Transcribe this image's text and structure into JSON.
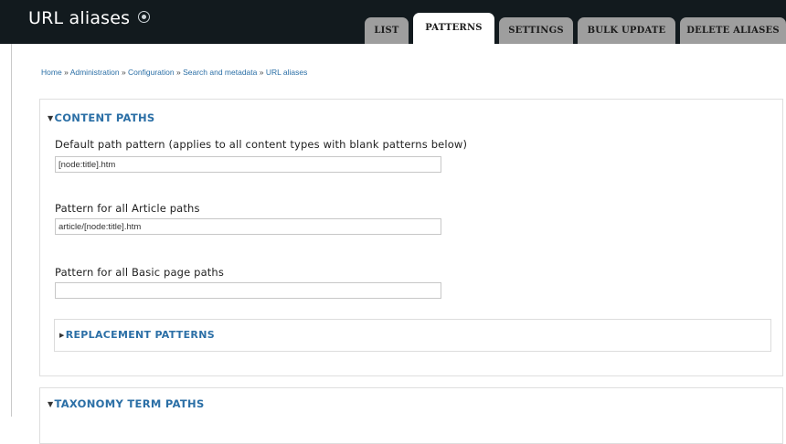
{
  "header": {
    "title": "URL aliases",
    "tabs": [
      {
        "label": "LIST",
        "active": false
      },
      {
        "label": "PATTERNS",
        "active": true
      },
      {
        "label": "SETTINGS",
        "active": false
      },
      {
        "label": "BULK UPDATE",
        "active": false
      },
      {
        "label": "DELETE ALIASES",
        "active": false
      }
    ]
  },
  "breadcrumb": {
    "items": [
      "Home",
      "Administration",
      "Configuration",
      "Search and metadata",
      "URL aliases"
    ],
    "separator": "»"
  },
  "content_paths": {
    "legend": "CONTENT PATHS",
    "default_pattern": {
      "label": "Default path pattern (applies to all content types with blank patterns below)",
      "value": "[node:title].htm"
    },
    "article_pattern": {
      "label": "Pattern for all Article paths",
      "value": "article/[node:title].htm"
    },
    "basic_page_pattern": {
      "label": "Pattern for all Basic page paths",
      "value": ""
    },
    "replacement_patterns": {
      "label": "REPLACEMENT PATTERNS"
    }
  },
  "taxonomy_paths": {
    "legend": "TAXONOMY TERM PATHS"
  },
  "colors": {
    "header_bg": "#121a1e",
    "tab_bg": "#9e9e9e",
    "link": "#2b6fa6"
  }
}
